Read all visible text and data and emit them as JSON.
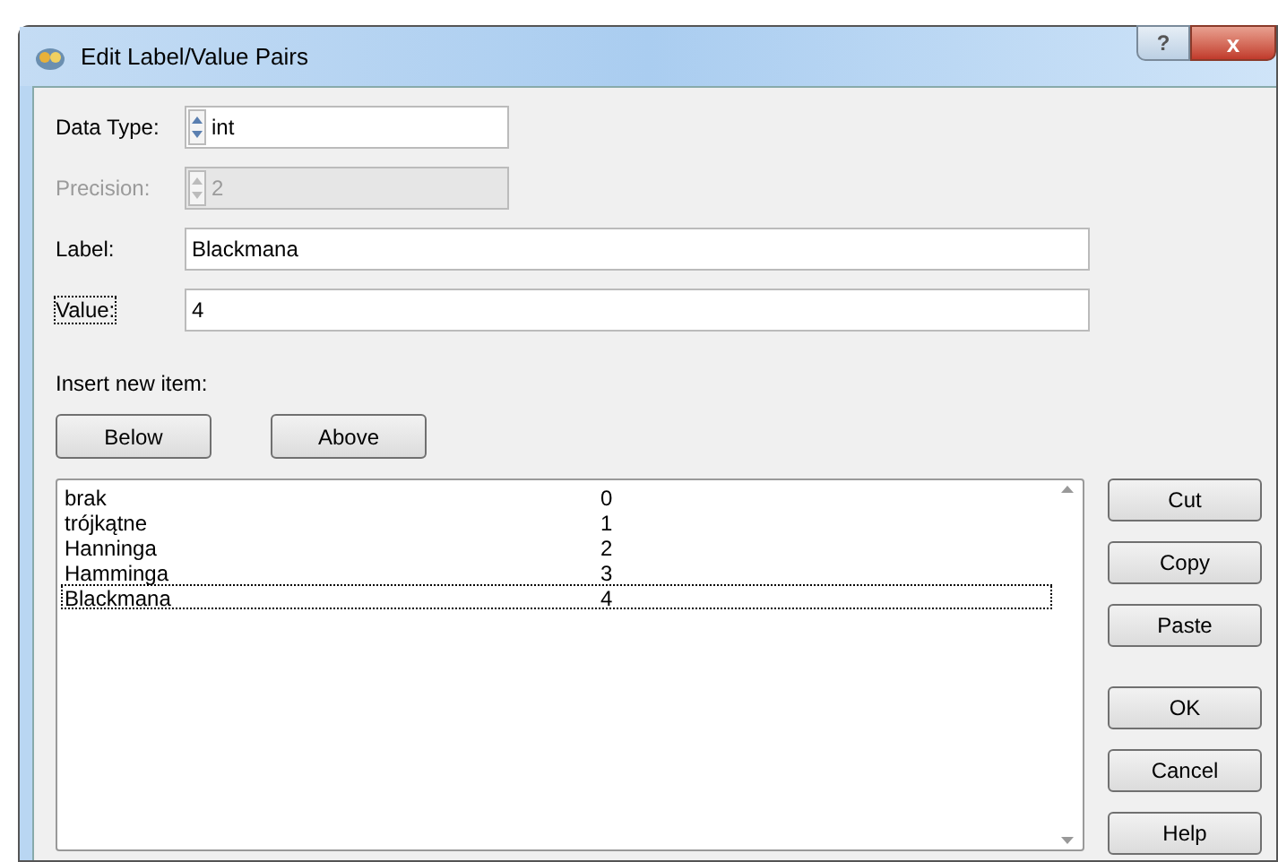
{
  "window": {
    "title": "Edit Label/Value Pairs"
  },
  "title_buttons": [
    {
      "kind": "help",
      "label": "?"
    },
    {
      "kind": "close",
      "label": "x"
    }
  ],
  "fields": [
    {
      "kind": "spin",
      "label": "Data Type:",
      "value": "int",
      "disabled": false,
      "focused": false
    },
    {
      "kind": "spin",
      "label": "Precision:",
      "value": "2",
      "disabled": true,
      "focused": false
    },
    {
      "kind": "text",
      "label": "Label:",
      "value": "Blackmana",
      "disabled": false,
      "focused": false
    },
    {
      "kind": "text",
      "label": "Value:",
      "value": "4",
      "disabled": false,
      "focused": true
    }
  ],
  "insert_label": "Insert new item:",
  "insert_buttons": [
    "Below",
    "Above"
  ],
  "list": {
    "rows": [
      {
        "label": "brak",
        "value": "0",
        "selected": false
      },
      {
        "label": "trójkątne",
        "value": "1",
        "selected": false
      },
      {
        "label": "Hanninga",
        "value": "2",
        "selected": false
      },
      {
        "label": "Hamminga",
        "value": "3",
        "selected": false
      },
      {
        "label": "Blackmana",
        "value": "4",
        "selected": true
      }
    ]
  },
  "edit_buttons": [
    "Cut",
    "Copy",
    "Paste"
  ],
  "dialog_buttons": [
    "OK",
    "Cancel",
    "Help"
  ]
}
